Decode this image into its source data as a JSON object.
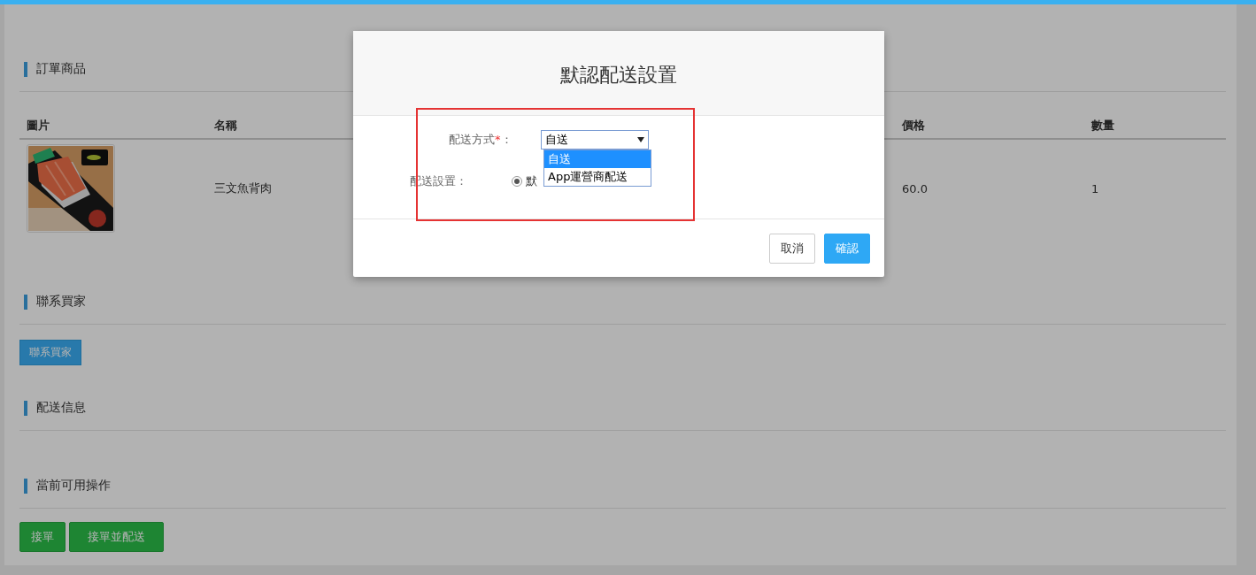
{
  "page": {
    "sections": [
      {
        "title": "訂單商品",
        "kind": "table"
      },
      {
        "title": "聯系買家",
        "kind": "buttons"
      },
      {
        "title": "配送信息",
        "kind": "empty"
      },
      {
        "title": "當前可用操作",
        "kind": "actions"
      }
    ],
    "order_table": {
      "columns": [
        "圖片",
        "名稱",
        "價格",
        "數量"
      ],
      "rows": [
        {
          "name": "三文魚背肉",
          "price": "60.0",
          "quantity": "1"
        }
      ]
    },
    "contact_buttons": [
      "聯系買家"
    ],
    "action_buttons": [
      "接單",
      "接單並配送"
    ]
  },
  "dialog": {
    "title": "默認配送設置",
    "fields": [
      {
        "kind": "select",
        "label": "配送方式",
        "required_mark": "*",
        "label_end": "：",
        "value": "自送",
        "expanded": true,
        "options": [
          {
            "label": "自送",
            "selected": true
          },
          {
            "label": "App運營商配送",
            "selected": false
          }
        ]
      },
      {
        "kind": "radio",
        "label": "配送設置：",
        "options": [
          {
            "label": "默",
            "selected": true
          }
        ]
      }
    ],
    "buttons": [
      {
        "label": "取消",
        "kind": "secondary"
      },
      {
        "label": "確認",
        "kind": "primary"
      }
    ],
    "highlight": true
  }
}
